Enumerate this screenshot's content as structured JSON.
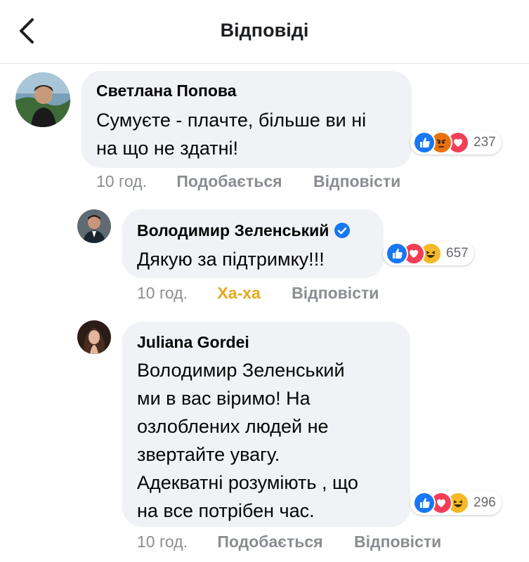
{
  "header": {
    "title": "Відповіді"
  },
  "comments": [
    {
      "author": "Светлана Попова",
      "text": [
        "Сумуєте - плачте, більше ви ні",
        "на що не здатні!"
      ],
      "reaction_count": "237",
      "reactions": [
        "like-icon",
        "angry-icon",
        "love-icon"
      ],
      "time": "10 год.",
      "like_label": "Подобається",
      "reply_label": "Відповісти"
    },
    {
      "author": "Володимир Зеленський",
      "verified": true,
      "text": [
        "Дякую за підтримку!!!"
      ],
      "reaction_count": "657",
      "reactions": [
        "like-icon",
        "love-icon",
        "haha-icon"
      ],
      "time": "10 год.",
      "like_label": "Ха-ха",
      "reply_label": "Відповісти"
    },
    {
      "author": "Juliana Gordei",
      "text": [
        "Володимир Зеленський",
        "ми в вас віримо! На",
        "озлоблених людей не",
        "звертайте увагу.",
        "Адекватні розуміють , що",
        "на все потрібен час."
      ],
      "reaction_count": "296",
      "reactions": [
        "like-icon",
        "love-icon",
        "haha-icon"
      ],
      "time": "10 год.",
      "like_label": "Подобається",
      "reply_label": "Відповісти"
    }
  ],
  "colors": {
    "like": "#1877f2",
    "love": "#f33e58",
    "haha": "#f7b928",
    "angry": "#e9710f",
    "haha_label": "#e7a81c"
  }
}
